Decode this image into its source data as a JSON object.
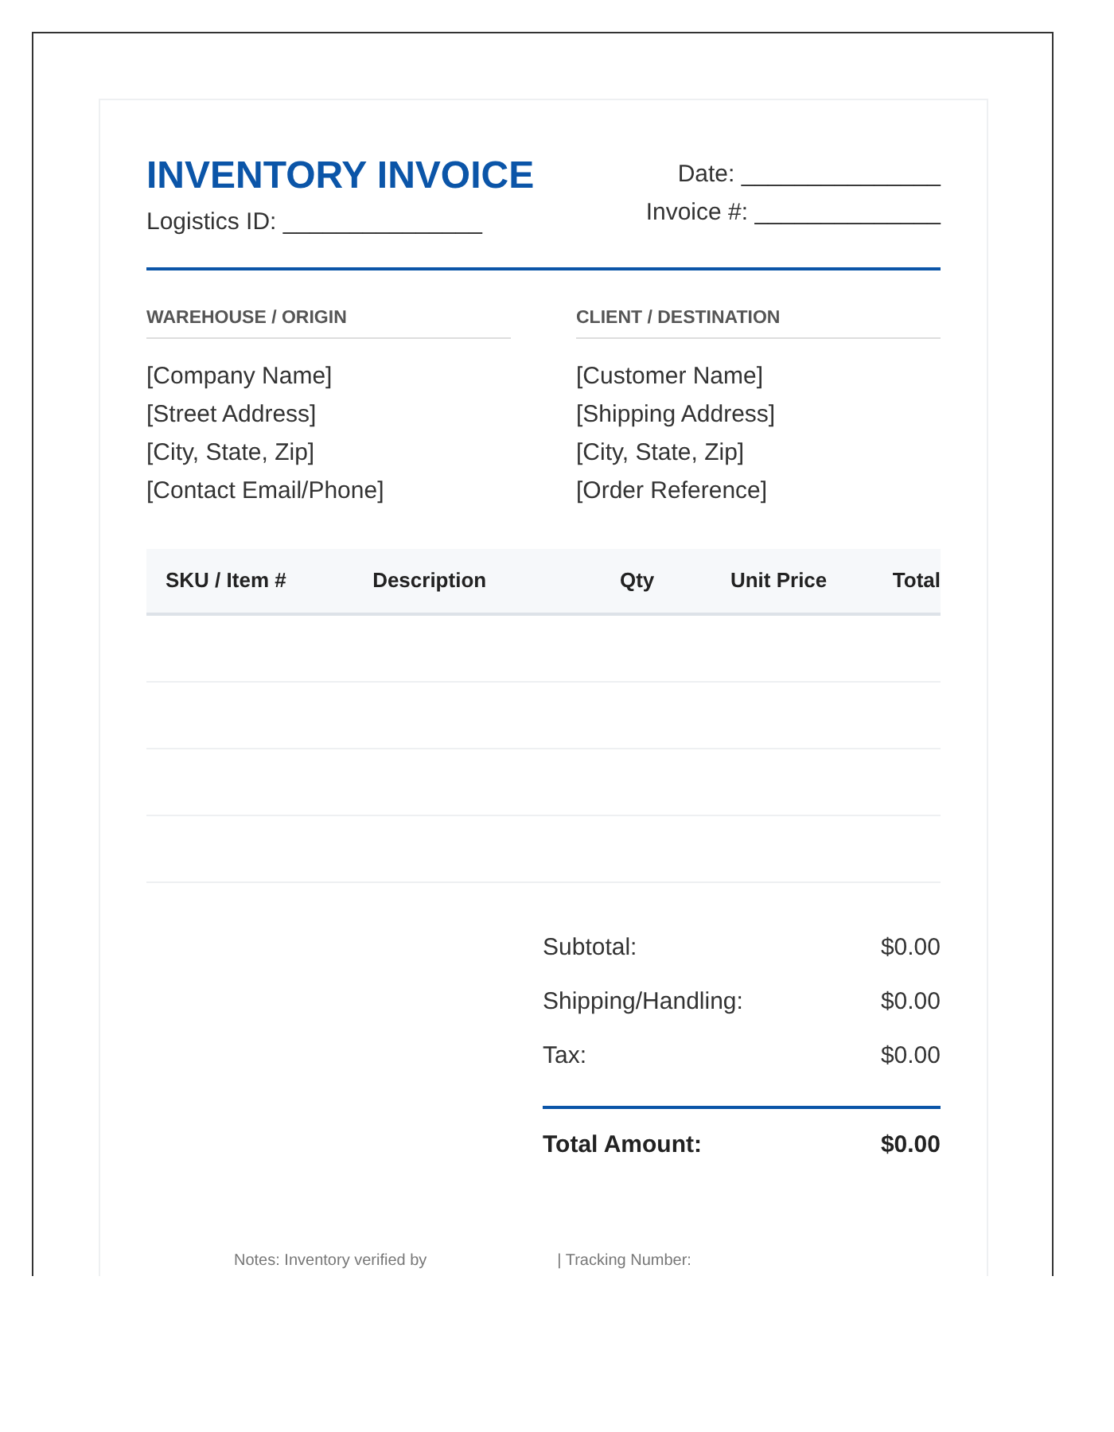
{
  "header": {
    "title": "INVENTORY INVOICE",
    "logistics_id": "Logistics ID: _______________",
    "date": "Date: _______________",
    "invoice_number": "Invoice #: ______________"
  },
  "parties": [
    {
      "heading": "WAREHOUSE / ORIGIN",
      "lines": [
        "[Company Name]",
        "[Street Address]",
        "[City, State, Zip]",
        "[Contact Email/Phone]"
      ]
    },
    {
      "heading": "CLIENT / DESTINATION",
      "lines": [
        "[Customer Name]",
        "[Shipping Address]",
        "[City, State, Zip]",
        "[Order Reference]"
      ]
    }
  ],
  "table": {
    "columns": [
      "SKU / Item #",
      "Description",
      "Qty",
      "Unit Price",
      "Total"
    ]
  },
  "totals": [
    {
      "kind": "line",
      "label": "Subtotal:",
      "value": "$0.00"
    },
    {
      "kind": "line",
      "label": "Shipping/Handling:",
      "value": "$0.00"
    },
    {
      "kind": "line",
      "label": "Tax:",
      "value": "$0.00"
    },
    {
      "kind": "grand",
      "label": "Total Amount:",
      "value": "$0.00"
    }
  ],
  "footer": [
    "Notes: Inventory verified by",
    "| Tracking Number:"
  ]
}
